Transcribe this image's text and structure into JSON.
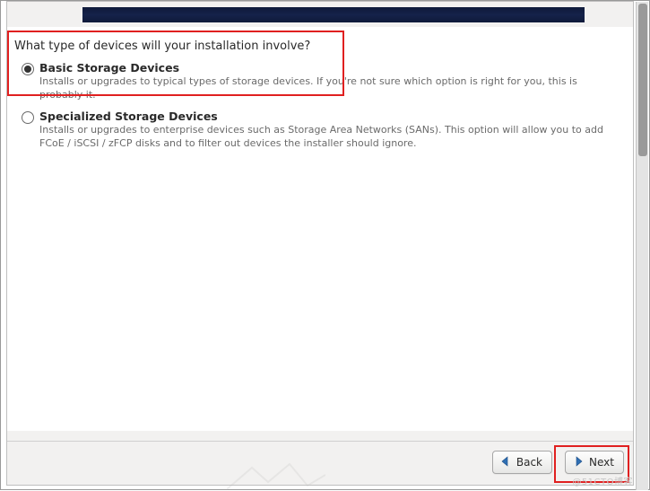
{
  "question": "What type of devices will your installation involve?",
  "options": [
    {
      "title": "Basic Storage Devices",
      "desc": "Installs or upgrades to typical types of storage devices.  If you're not sure which option is right for you, this is probably it.",
      "selected": true
    },
    {
      "title": "Specialized Storage Devices",
      "desc": "Installs or upgrades to enterprise devices such as Storage Area Networks (SANs). This option will allow you to add FCoE / iSCSI / zFCP disks and to filter out devices the installer should ignore.",
      "selected": false
    }
  ],
  "buttons": {
    "back": "Back",
    "next": "Next"
  },
  "watermark": "@51CTO博客"
}
